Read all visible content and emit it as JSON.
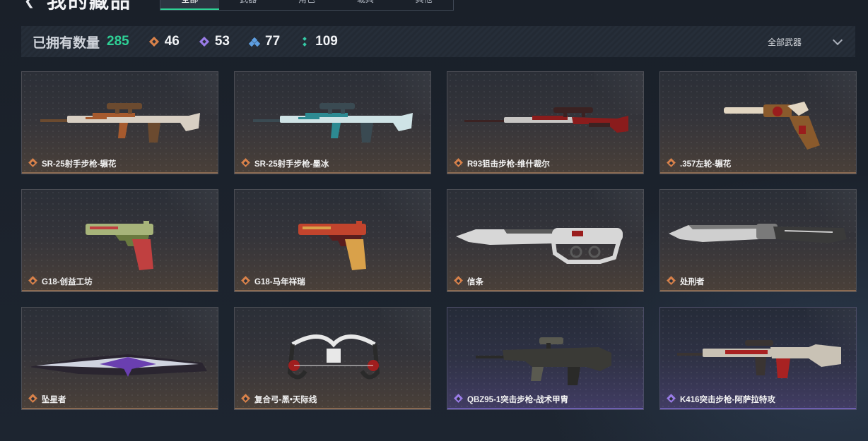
{
  "header": {
    "back_icon": "back-arrow-icon",
    "title": "我的藏品",
    "tabs": [
      {
        "label": "全部"
      },
      {
        "label": "武器"
      },
      {
        "label": "角色"
      },
      {
        "label": "载具"
      },
      {
        "label": "其他"
      }
    ]
  },
  "stats": {
    "owned_label": "已拥有数量",
    "owned_count": "285",
    "rarities": [
      {
        "icon": "orange-diamond-icon",
        "color": "#d9824a",
        "value": "46"
      },
      {
        "icon": "purple-diamond-icon",
        "color": "#9a7ce8",
        "value": "53"
      },
      {
        "icon": "blue-triple-diamond-icon",
        "color": "#5e9ee0",
        "value": "77"
      },
      {
        "icon": "green-dots-icon",
        "color": "#35c9a6",
        "value": "109"
      }
    ],
    "filter_label": "全部武器",
    "filter_icon": "chevron-down-icon"
  },
  "items": [
    {
      "name": "SR-25射手步枪-辗花",
      "rarity": "orange",
      "kind": "sniper-rifle",
      "palette": [
        "#d8cfc3",
        "#a65a2e",
        "#6b4a2f"
      ]
    },
    {
      "name": "SR-25射手步枪-墨冰",
      "rarity": "orange",
      "kind": "sniper-rifle",
      "palette": [
        "#cfe3e6",
        "#2d8a92",
        "#3a4a52"
      ]
    },
    {
      "name": "R93狙击步枪-维什裁尔",
      "rarity": "orange",
      "kind": "bolt-rifle",
      "palette": [
        "#c8c6c4",
        "#8a1c1c",
        "#3b2222"
      ]
    },
    {
      "name": ".357左轮-辗花",
      "rarity": "orange",
      "kind": "revolver",
      "palette": [
        "#e2d6c2",
        "#9a1d1d",
        "#8a5a2c"
      ]
    },
    {
      "name": "G18-创益工坊",
      "rarity": "orange",
      "kind": "pistol",
      "palette": [
        "#a7b47a",
        "#c04040",
        "#6a7a40"
      ]
    },
    {
      "name": "G18-马年祥瑞",
      "rarity": "orange",
      "kind": "pistol",
      "palette": [
        "#c2442d",
        "#d9a14a",
        "#5a1d1d"
      ]
    },
    {
      "name": "信条",
      "rarity": "orange",
      "kind": "knife-knuckle",
      "palette": [
        "#d7d7d7",
        "#9a1d1d",
        "#5a5a5a"
      ]
    },
    {
      "name": "处刑者",
      "rarity": "orange",
      "kind": "knife",
      "palette": [
        "#cfcfcf",
        "#3a3a3a",
        "#7a7a7a"
      ]
    },
    {
      "name": "坠星者",
      "rarity": "orange",
      "kind": "blade",
      "palette": [
        "#d0d4e0",
        "#6a3fb0",
        "#2a2530"
      ]
    },
    {
      "name": "复合弓-黑•天际线",
      "rarity": "orange",
      "kind": "bow",
      "palette": [
        "#e8e8e8",
        "#2a2a2a",
        "#a01e1e"
      ]
    },
    {
      "name": "QBZ95-1突击步枪-战术甲胄",
      "rarity": "purple",
      "kind": "bullpup",
      "palette": [
        "#3a3a36",
        "#5a5a50",
        "#2a2a28"
      ]
    },
    {
      "name": "K416突击步枪-阿萨拉特攻",
      "rarity": "purple",
      "kind": "assault-rifle",
      "palette": [
        "#c9c2b5",
        "#a82222",
        "#3a3432"
      ]
    }
  ]
}
